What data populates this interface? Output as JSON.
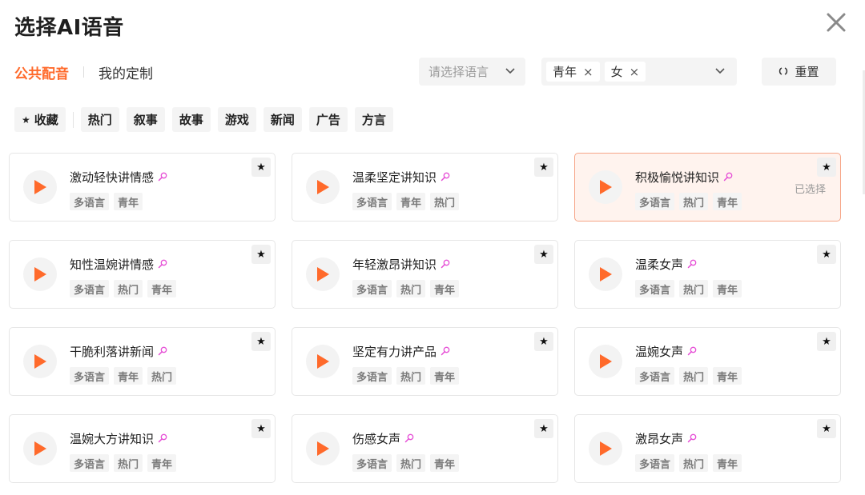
{
  "dialog": {
    "title": "选择AI语音"
  },
  "tabs": [
    {
      "label": "公共配音",
      "active": true
    },
    {
      "label": "我的定制",
      "active": false
    }
  ],
  "language_select": {
    "placeholder": "请选择语言"
  },
  "tag_select": {
    "chips": [
      "青年",
      "女"
    ]
  },
  "reset_label": "重置",
  "favorites_label": "收藏",
  "categories": [
    "热门",
    "叙事",
    "故事",
    "游戏",
    "新闻",
    "广告",
    "方言"
  ],
  "selected_text": "已选择",
  "colors": {
    "accent": "#ff6a2b",
    "selected_bg": "#fff3ee",
    "mic_pink": "#e64fd6"
  },
  "voices": [
    {
      "name": "激动轻快讲情感",
      "tags": [
        "多语言",
        "青年"
      ],
      "selected": false
    },
    {
      "name": "温柔坚定讲知识",
      "tags": [
        "多语言",
        "青年",
        "热门"
      ],
      "selected": false
    },
    {
      "name": "积极愉悦讲知识",
      "tags": [
        "多语言",
        "热门",
        "青年"
      ],
      "selected": true
    },
    {
      "name": "知性温婉讲情感",
      "tags": [
        "多语言",
        "热门",
        "青年"
      ],
      "selected": false
    },
    {
      "name": "年轻激昂讲知识",
      "tags": [
        "多语言",
        "热门",
        "青年"
      ],
      "selected": false
    },
    {
      "name": "温柔女声",
      "tags": [
        "多语言",
        "热门",
        "青年"
      ],
      "selected": false
    },
    {
      "name": "干脆利落讲新闻",
      "tags": [
        "多语言",
        "青年",
        "热门"
      ],
      "selected": false
    },
    {
      "name": "坚定有力讲产品",
      "tags": [
        "多语言",
        "热门",
        "青年"
      ],
      "selected": false
    },
    {
      "name": "温婉女声",
      "tags": [
        "多语言",
        "热门",
        "青年"
      ],
      "selected": false
    },
    {
      "name": "温婉大方讲知识",
      "tags": [
        "多语言",
        "热门",
        "青年"
      ],
      "selected": false
    },
    {
      "name": "伤感女声",
      "tags": [
        "多语言",
        "热门",
        "青年"
      ],
      "selected": false
    },
    {
      "name": "激昂女声",
      "tags": [
        "多语言",
        "热门",
        "青年"
      ],
      "selected": false
    }
  ]
}
